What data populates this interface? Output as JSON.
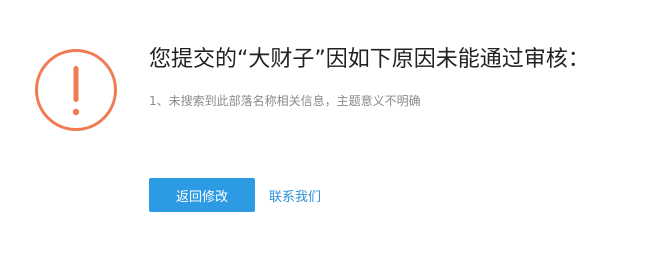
{
  "icon": {
    "name": "warning-exclamation-icon",
    "color": "#f07b52"
  },
  "message": {
    "title": "您提交的“大财子”因如下原因未能通过审核：",
    "reason": "1、未搜索到此部落名称相关信息，主题意义不明确"
  },
  "actions": {
    "primary_label": "返回修改",
    "link_label": "联系我们"
  },
  "colors": {
    "accent": "#2d9be3",
    "link": "#2d8fd8",
    "warning": "#f07b52"
  }
}
